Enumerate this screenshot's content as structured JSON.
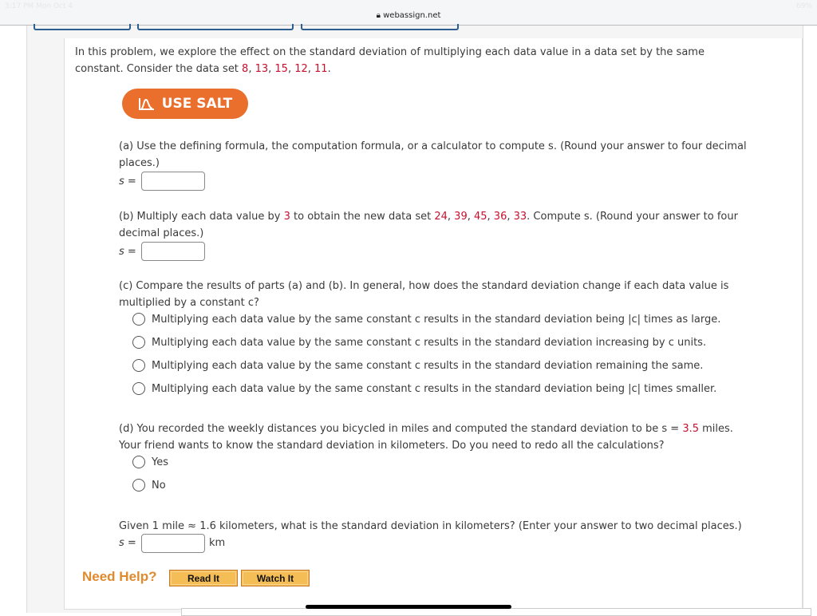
{
  "status": {
    "time": "3:17 PM  Mon Oct 4",
    "battery": "69%"
  },
  "browser": {
    "url": "webassign.net"
  },
  "intro": {
    "text": "In this problem, we explore the effect on the standard deviation of multiplying each data value in a data set by the same",
    "text2": "constant. Consider the data set ",
    "values": [
      "8",
      "13",
      "15",
      "12",
      "11"
    ]
  },
  "salt": {
    "label": "USE SALT"
  },
  "a": {
    "line1": "(a) Use the defining formula, the computation formula, or a calculator to compute s. (Round your answer to four decimal",
    "line2": "places.)",
    "s_label": "s =",
    "value": ""
  },
  "b": {
    "pre": "(b) Multiply each data value by ",
    "factor": "3",
    "mid": " to obtain the new data set ",
    "values": [
      "24",
      "39",
      "45",
      "36",
      "33"
    ],
    "post": ". Compute s. (Round your answer to four",
    "line2": "decimal places.)",
    "s_label": "s =",
    "value": ""
  },
  "c": {
    "line1": "(c) Compare the results of parts (a) and (b). In general, how does the standard deviation change if each data value is",
    "line2": "multiplied by a constant c?",
    "options": [
      "Multiplying each data value by the same constant c results in the standard deviation being |c| times as large.",
      "Multiplying each data value by the same constant c results in the standard deviation increasing by c units.",
      "Multiplying each data value by the same constant c results in the standard deviation remaining the same.",
      "Multiplying each data value by the same constant c results in the standard deviation being |c| times smaller."
    ]
  },
  "d": {
    "pre": "(d) You recorded the weekly distances you bicycled in miles and computed the standard deviation to be s = ",
    "value": "3.5",
    "post": " miles.",
    "line2": "Your friend wants to know the standard deviation in kilometers. Do you need to redo all the calculations?",
    "options": [
      "Yes",
      "No"
    ],
    "q": "Given 1 mile ≈ 1.6 kilometers, what is the standard deviation in kilometers? (Enter your answer to two decimal places.)",
    "s_label": "s =",
    "unit": "km",
    "answer": ""
  },
  "help": {
    "label": "Need Help?",
    "read": "Read It",
    "watch": "Watch It"
  }
}
